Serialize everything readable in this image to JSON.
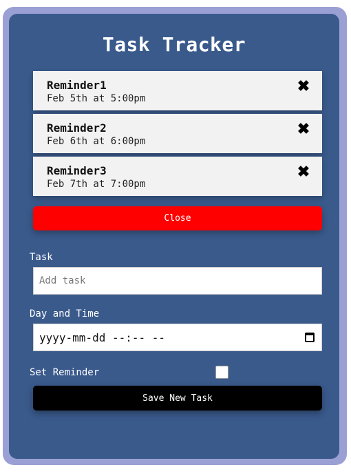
{
  "app": {
    "title": "Task Tracker"
  },
  "tasks": [
    {
      "name": "Reminder1",
      "when": "Feb 5th at 5:00pm",
      "delete_icon": "close-icon"
    },
    {
      "name": "Reminder2",
      "when": "Feb 6th at 6:00pm",
      "delete_icon": "close-icon"
    },
    {
      "name": "Reminder3",
      "when": "Feb 7th at 7:00pm",
      "delete_icon": "close-icon"
    }
  ],
  "close_button": {
    "label": "Close",
    "color": "#ff0000"
  },
  "form": {
    "task_label": "Task",
    "task_placeholder": "Add task",
    "task_value": "",
    "datetime_label": "Day and Time",
    "datetime_placeholder": "yyyy-mm-dd --:-- --",
    "datetime_icon": "calendar-icon",
    "reminder_label": "Set Reminder",
    "reminder_checked": false,
    "save_label": "Save New Task"
  },
  "colors": {
    "frame": "#9ba0d4",
    "panel": "#3a5a8c",
    "save_button": "#000000"
  }
}
